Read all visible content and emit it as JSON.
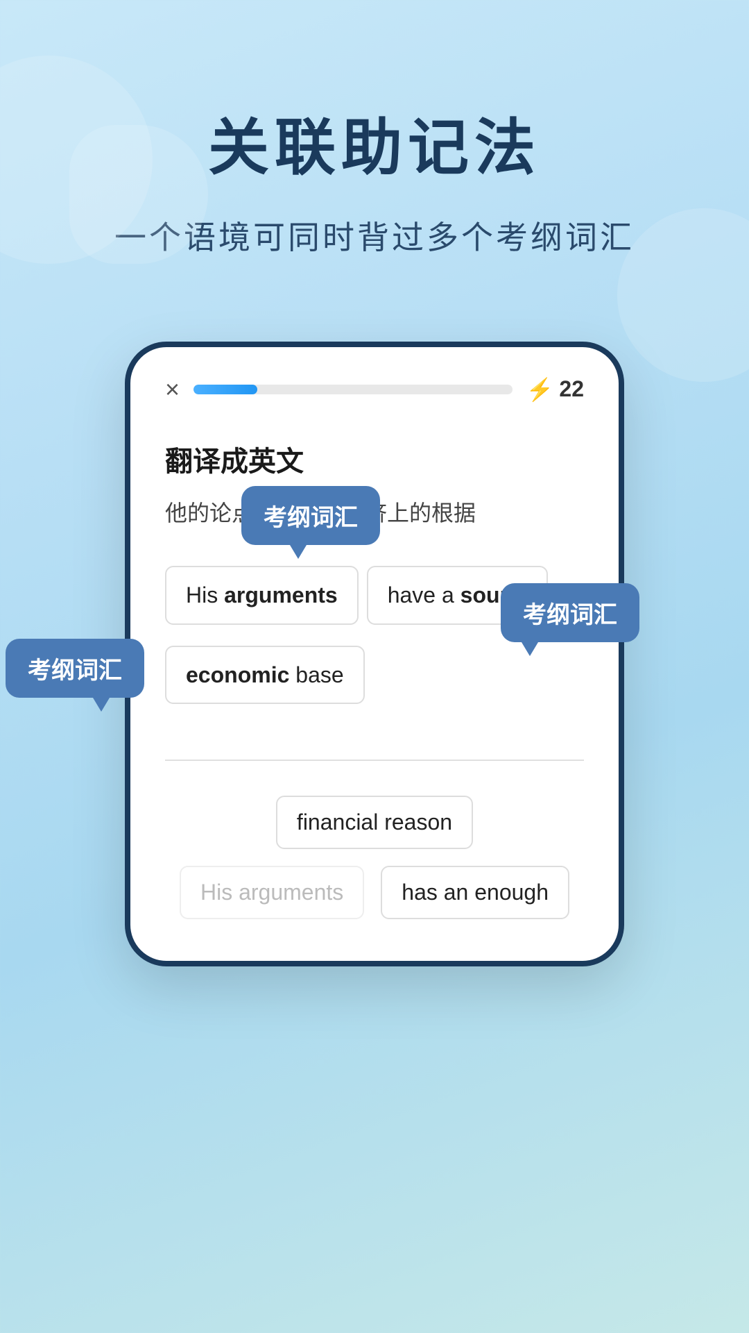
{
  "page": {
    "background": "linear-gradient(160deg, #c8e8f8 0%, #b8dff5 30%, #a8d8f0 60%, #c5e8e8 100%)"
  },
  "header": {
    "main_title": "关联助记法",
    "subtitle": "一个语境可同时背过多个考纲词汇"
  },
  "phone": {
    "progress_bar": {
      "close_label": "×",
      "score_value": "22"
    },
    "question": {
      "label": "翻译成英文",
      "text": "他的论点有充分的经济上的根据"
    },
    "answer_options": [
      {
        "text": "His arguments",
        "bold": "arguments"
      },
      {
        "text": "have a sound",
        "bold": "sound"
      },
      {
        "text": "economic base",
        "bold": "economic"
      }
    ],
    "bottom_options": [
      {
        "text": "financial reason",
        "dimmed": false
      },
      {
        "text": "has an enough",
        "dimmed": true,
        "dimmed_word": "His arguments"
      }
    ],
    "divider": true
  },
  "tooltips": [
    {
      "id": "tooltip-1",
      "label": "考纲词汇",
      "position": "above-arguments"
    },
    {
      "id": "tooltip-2",
      "label": "考纲词汇",
      "position": "right-sound"
    },
    {
      "id": "tooltip-3",
      "label": "考纲词汇",
      "position": "left-economic"
    }
  ]
}
